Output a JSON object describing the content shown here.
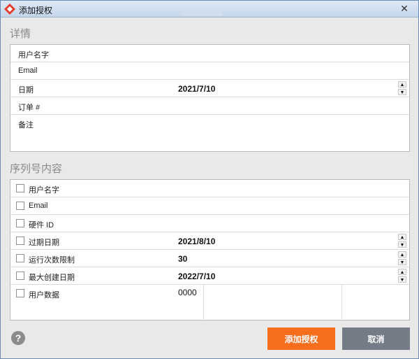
{
  "window": {
    "title": "添加授权",
    "close_label": "✕"
  },
  "details": {
    "title": "详情",
    "rows": [
      {
        "label": "用户名字",
        "value": ""
      },
      {
        "label": "Email",
        "value": ""
      },
      {
        "label": "日期",
        "value": "2021/7/10"
      },
      {
        "label": "订单 #",
        "value": ""
      },
      {
        "label": "备注",
        "value": ""
      }
    ]
  },
  "serial": {
    "title": "序列号内容",
    "rows": [
      {
        "label": "用户名字",
        "value": ""
      },
      {
        "label": "Email",
        "value": ""
      },
      {
        "label": "硬件 ID",
        "value": ""
      },
      {
        "label": "过期日期",
        "value": "2021/8/10"
      },
      {
        "label": "运行次数限制",
        "value": "30"
      },
      {
        "label": "最大创建日期",
        "value": "2022/7/10"
      },
      {
        "label": "用户数据",
        "value": "0000"
      }
    ]
  },
  "spin": {
    "up": "▲",
    "down": "▼"
  },
  "footer": {
    "help": "?",
    "add_label": "添加授权",
    "cancel_label": "取消"
  },
  "colors": {
    "primary": "#f66d1c",
    "secondary": "#737c87",
    "titlebar": "#c4d6ec"
  }
}
